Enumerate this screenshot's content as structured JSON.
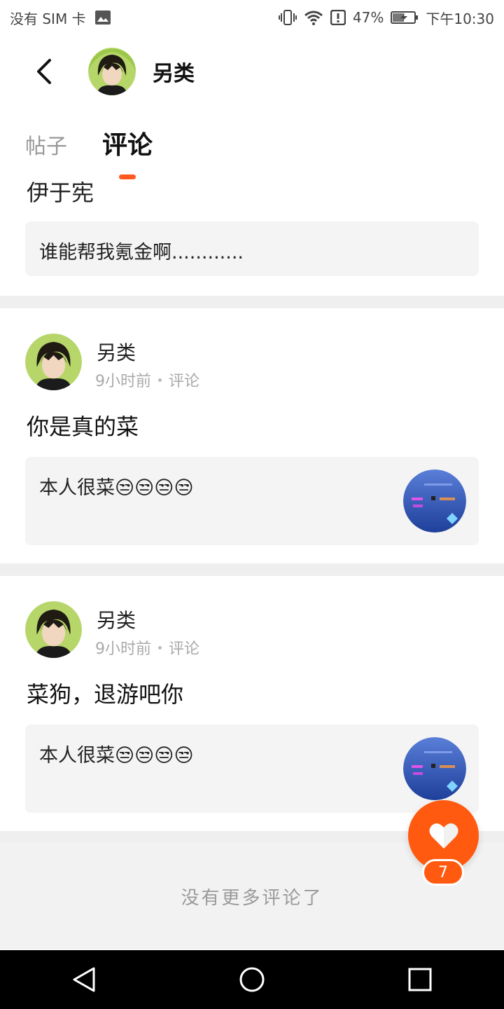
{
  "status_bar": {
    "carrier": "没有 SIM 卡",
    "battery_percent": "47%",
    "time": "下午10:30",
    "icons": [
      "image-icon",
      "vibrate-icon",
      "wifi-icon",
      "alert-icon",
      "battery-icon"
    ]
  },
  "header": {
    "back_icon": "back-arrow-icon",
    "user_name": "另类"
  },
  "tabs": [
    {
      "label": "帖子",
      "active": false
    },
    {
      "label": "评论",
      "active": true
    }
  ],
  "partial_comment": {
    "text_fragment": "伊于宪",
    "quote": "谁能帮我氪金啊............"
  },
  "comments": [
    {
      "author": "另类",
      "time": "9小时前",
      "type": "评论",
      "text": "你是真的菜",
      "quote": "本人很菜😒😒😒😒"
    },
    {
      "author": "另类",
      "time": "9小时前",
      "type": "评论",
      "text": "菜狗，退游吧你",
      "quote": "本人很菜😒😒😒😒"
    }
  ],
  "footer": {
    "no_more_text": "没有更多评论了"
  },
  "like_fab": {
    "icon": "heart-icon",
    "count": "7"
  },
  "nav_bar": {
    "icons": [
      "back-triangle-icon",
      "home-circle-icon",
      "recents-square-icon"
    ]
  },
  "colors": {
    "accent": "#ff5a10",
    "divider": "#efefef",
    "quote_bg": "#f4f4f4",
    "muted_text": "#aaaaaa"
  }
}
